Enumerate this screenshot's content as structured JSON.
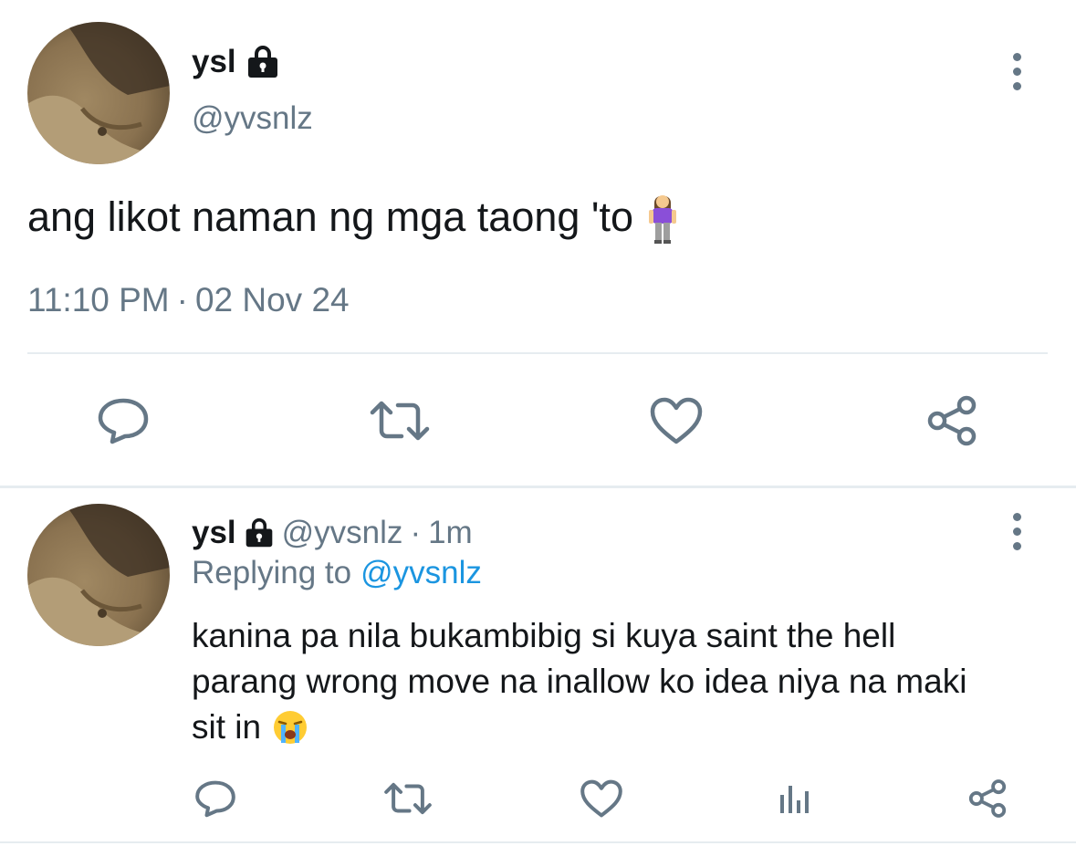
{
  "main_tweet": {
    "name": "ysl",
    "handle": "@yvsnlz",
    "text": "ang likot naman ng mga taong 'to",
    "emoji": "woman-standing-emoji",
    "time": "11:10 PM",
    "separator": "·",
    "date": "02 Nov 24",
    "locked_icon": "lock-icon",
    "actions": [
      "reply-icon",
      "retweet-icon",
      "like-icon",
      "share-icon"
    ]
  },
  "reply_tweet": {
    "name": "ysl",
    "handle": "@yvsnlz",
    "separator": "·",
    "age": "1m",
    "replying_prefix": "Replying to",
    "replying_to": "@yvsnlz",
    "text_line1": "kanina pa nila bukambibig si kuya saint the hell",
    "text_line2": "parang wrong move na inallow ko idea niya na maki",
    "text_line3": "sit in",
    "emoji": "loudly-crying-face-emoji",
    "actions": [
      "reply-icon",
      "retweet-icon",
      "like-icon",
      "analytics-icon",
      "share-icon"
    ]
  },
  "colors": {
    "text": "#14171a",
    "muted": "#657786",
    "link": "#1b95e0",
    "divider": "#e6ecf0"
  }
}
